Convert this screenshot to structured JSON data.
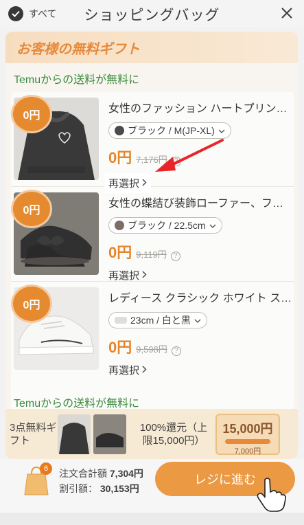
{
  "header": {
    "select_all_label": "すべて",
    "title": "ショッピングバッグ",
    "close_icon": "close-icon"
  },
  "gift_banner": {
    "title": "お客様の無料ギフト"
  },
  "shipping_note": "Temuからの送料が無料に",
  "items": [
    {
      "badge": "0円",
      "title": "女性のファッション ハートプリント ...",
      "variant": "ブラック / M(JP-XL)",
      "price": "0円",
      "old_price": "7,176円",
      "reselect": "再選択"
    },
    {
      "badge": "0円",
      "title": "女性の蝶結び装飾ローファー、ファッ...",
      "variant": "ブラック / 22.5cm",
      "price": "0円",
      "old_price": "9,119円",
      "reselect": "再選択"
    },
    {
      "badge": "0円",
      "title": "レディース クラシック ホワイト スニ...",
      "variant": "23cm / 白と黒",
      "price": "0円",
      "old_price": "9,598円",
      "reselect": "再選択"
    }
  ],
  "gift_bar": {
    "count_label": "3点無料ギフト",
    "refund_label": "100%還元（上限15,000円）",
    "coupon_amount": "15,000円",
    "coupon_sub": "7,000円"
  },
  "footer": {
    "bag_count": "6",
    "total_label": "注文合計額",
    "total_value": "7,304円",
    "discount_label": "割引額：",
    "discount_value": "30,153円",
    "checkout_label": "レジに進む"
  },
  "colors": {
    "accent": "#e98b2a",
    "price": "#e2760f",
    "green": "#1f7a1f",
    "annotation_arrow": "#e8262a"
  }
}
